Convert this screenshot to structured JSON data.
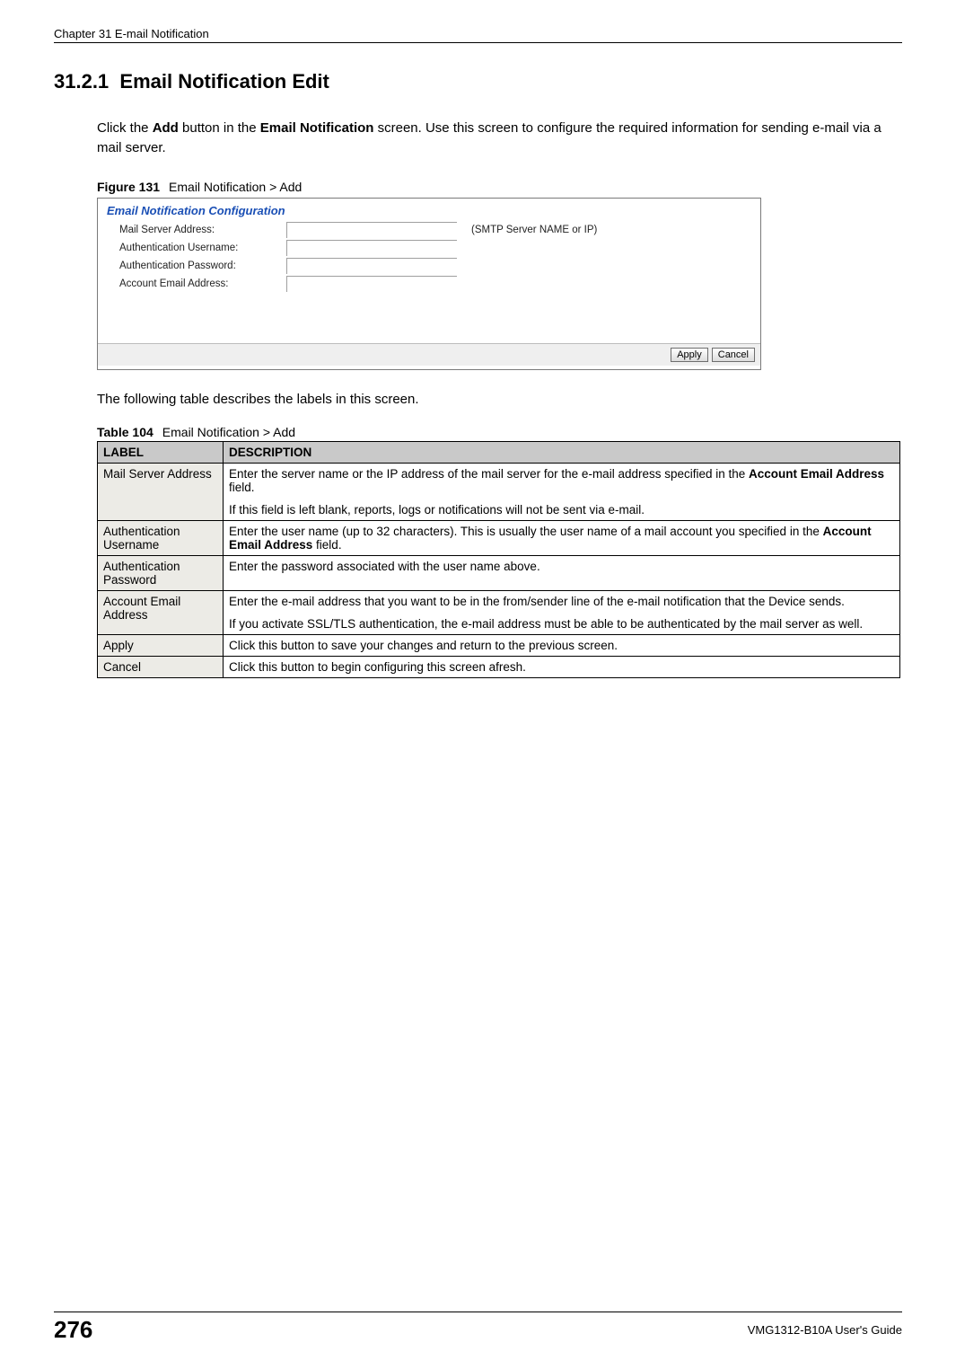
{
  "header": {
    "chapter": "Chapter 31 E-mail Notification"
  },
  "section": {
    "number": "31.2.1",
    "title": "Email Notification Edit"
  },
  "intro": {
    "pre": "Click the ",
    "btn": "Add",
    "mid1": " button in the ",
    "screen": "Email Notification",
    "mid2": " screen. Use this screen to configure the required information for sending e-mail via a mail server."
  },
  "figure": {
    "label": "Figure 131",
    "title": "Email Notification > Add"
  },
  "screenshot": {
    "panel_title": "Email Notification Configuration",
    "fields": {
      "mail_server": {
        "label": "Mail Server Address:",
        "hint": "(SMTP Server NAME or IP)"
      },
      "auth_user": {
        "label": "Authentication Username:"
      },
      "auth_pass": {
        "label": "Authentication Password:"
      },
      "acct_email": {
        "label": "Account Email Address:"
      }
    },
    "buttons": {
      "apply": "Apply",
      "cancel": "Cancel"
    }
  },
  "after_fig": "The following table describes the labels in this screen.",
  "table": {
    "caption_label": "Table 104",
    "caption_title": "Email Notification > Add",
    "headers": {
      "label": "LABEL",
      "description": "DESCRIPTION"
    },
    "rows": [
      {
        "label": "Mail Server Address",
        "desc1_pre": "Enter the server name or the IP address of the mail server for the e-mail address specified in the ",
        "desc1_bold": "Account Email Address",
        "desc1_post": " field.",
        "desc2": "If this field is left blank, reports, logs or notifications will not be sent via e-mail."
      },
      {
        "label": "Authentication Username",
        "desc1_pre": "Enter the user name (up to 32 characters). This is usually the user name of a mail account you specified in the ",
        "desc1_bold": "Account Email Address",
        "desc1_post": " field."
      },
      {
        "label": "Authentication Password",
        "desc1": "Enter the password associated with the user name above."
      },
      {
        "label": "Account Email Address",
        "desc1": "Enter the e-mail address that you want to be in the from/sender line of the e-mail notification that the Device sends.",
        "desc2": "If you activate SSL/TLS authentication, the e-mail address must be able to be authenticated by the mail server as well."
      },
      {
        "label": "Apply",
        "desc1": "Click this button to save your changes and return to the previous screen."
      },
      {
        "label": "Cancel",
        "desc1": "Click this button to begin configuring this screen afresh."
      }
    ]
  },
  "footer": {
    "page": "276",
    "guide": "VMG1312-B10A User's Guide"
  }
}
